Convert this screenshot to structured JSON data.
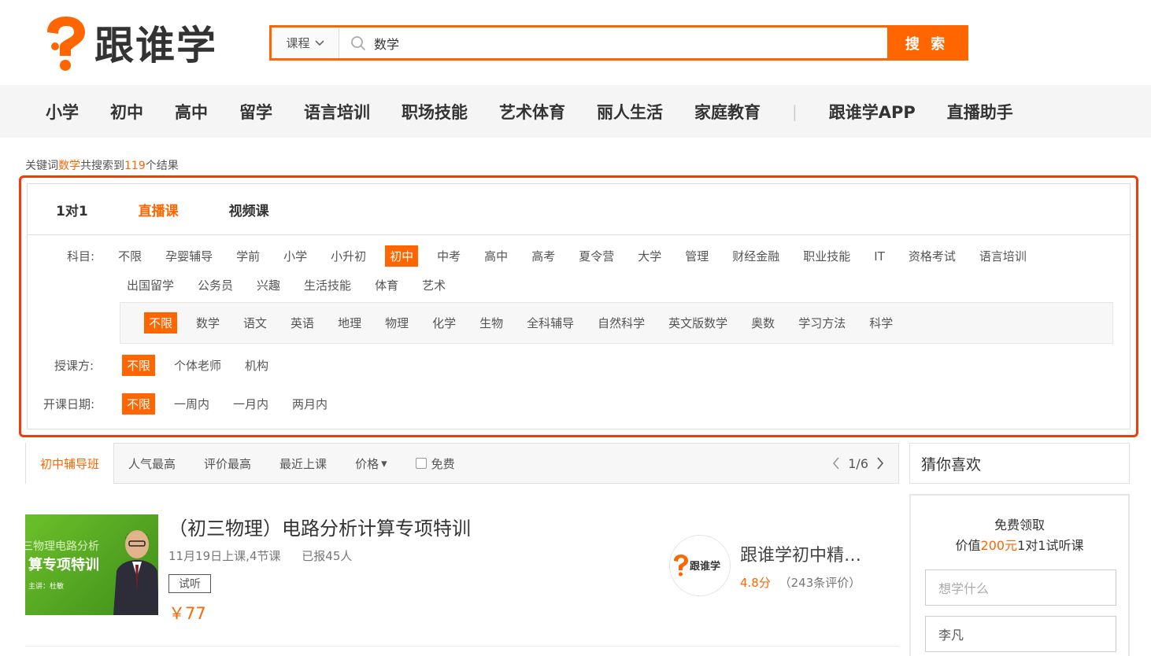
{
  "brand": {
    "name": "跟谁学",
    "accent": "#ff6600",
    "highlight_box": "#f03c0c"
  },
  "search": {
    "category": "课程",
    "query": "数学",
    "button": "搜 索"
  },
  "nav": {
    "items": [
      "小学",
      "初中",
      "高中",
      "留学",
      "语言培训",
      "职场技能",
      "艺术体育",
      "丽人生活",
      "家庭教育"
    ],
    "separator": "|",
    "extra": [
      "跟谁学APP",
      "直播助手"
    ]
  },
  "result": {
    "prefix": "关键词",
    "keyword": "数学",
    "mid": "共搜索到",
    "count": "119",
    "suffix": "个结果"
  },
  "filter": {
    "tabs": [
      "1对1",
      "直播课",
      "视频课"
    ],
    "active_tab": "直播课",
    "subject_label": "科目:",
    "subjects_row1": [
      "不限",
      "孕婴辅导",
      "学前",
      "小学",
      "小升初",
      "初中",
      "中考",
      "高中",
      "高考",
      "夏令营",
      "大学",
      "管理",
      "财经金融",
      "职业技能",
      "IT",
      "资格考试",
      "语言培训"
    ],
    "subjects_row2": [
      "出国留学",
      "公务员",
      "兴趣",
      "生活技能",
      "体育",
      "艺术"
    ],
    "selected_subject": "初中",
    "sub_subjects": [
      "不限",
      "数学",
      "语文",
      "英语",
      "地理",
      "物理",
      "化学",
      "生物",
      "全科辅导",
      "自然科学",
      "英文版数学",
      "奥数",
      "学习方法",
      "科学"
    ],
    "selected_sub": "不限",
    "teacher_label": "授课方:",
    "teacher_options": [
      "不限",
      "个体老师",
      "机构"
    ],
    "date_label": "开课日期:",
    "date_options": [
      "不限",
      "一周内",
      "一月内",
      "两月内"
    ]
  },
  "sortbar": {
    "items": [
      "初中辅导班",
      "人气最高",
      "评价最高",
      "最近上课",
      "价格"
    ],
    "active": "初中辅导班",
    "price_arrow": "▾",
    "free_label": "免费",
    "page": "1/6"
  },
  "course": {
    "thumb_line1": "三物理电路分析",
    "thumb_line2": "算专项特训",
    "thumb_line3": "主讲：杜敏",
    "title": "（初三物理）电路分析计算专项特训",
    "date": "11月19日上课,4节课",
    "enrolled": "已报45人",
    "badge": "试听",
    "price": "￥77",
    "org_logo_text": "跟谁学",
    "org_name": "跟谁学初中精…",
    "rating": "4.8分",
    "reviews": "（243条评价）"
  },
  "sidebar": {
    "title": "猜你喜欢",
    "line1": "免费领取",
    "line2_prefix": "价值",
    "line2_value": "200元",
    "line2_suffix": "1对1试听课",
    "input1_placeholder": "想学什么",
    "input2_value": "李凡"
  }
}
